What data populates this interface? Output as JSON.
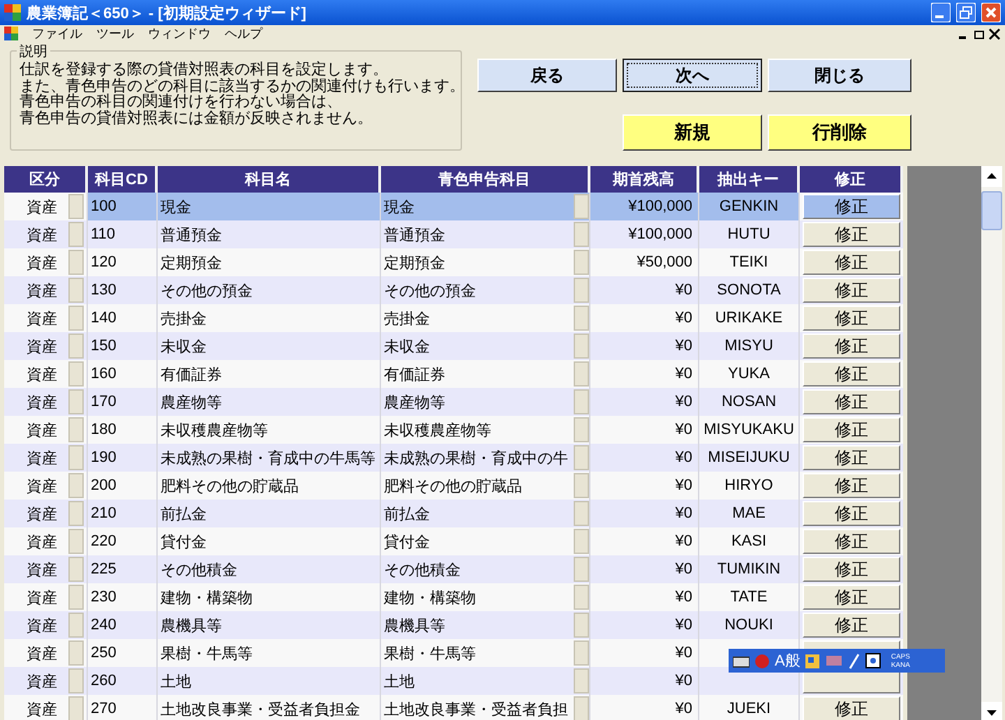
{
  "window": {
    "title": "農業簿記＜650＞ - [初期設定ウィザード]"
  },
  "menu": [
    "ファイル",
    "ツール",
    "ウィンドウ",
    "ヘルプ"
  ],
  "description": {
    "legend": "説明",
    "lines": [
      "仕訳を登録する際の貸借対照表の科目を設定します。",
      "また、青色申告のどの科目に該当するかの関連付けも行います。",
      "青色申告の科目の関連付けを行わない場合は、",
      "青色申告の貸借対照表には金額が反映されません。"
    ]
  },
  "nav_buttons": [
    {
      "label": "戻る",
      "focused": false
    },
    {
      "label": "次へ",
      "focused": true
    },
    {
      "label": "閉じる",
      "focused": false
    }
  ],
  "edit_buttons": [
    "新規",
    "行削除"
  ],
  "table": {
    "columns": [
      "区分",
      "科目CD",
      "科目名",
      "青色申告科目",
      "期首残高",
      "抽出キー",
      "修正"
    ],
    "rows": [
      {
        "category": "資産",
        "code": "100",
        "name": "現金",
        "blue_return_account": "現金",
        "opening_balance": "¥100,000",
        "key": "GENKIN",
        "action": "修正",
        "selected": true
      },
      {
        "category": "資産",
        "code": "110",
        "name": "普通預金",
        "blue_return_account": "普通預金",
        "opening_balance": "¥100,000",
        "key": "HUTU",
        "action": "修正",
        "selected": false
      },
      {
        "category": "資産",
        "code": "120",
        "name": "定期預金",
        "blue_return_account": "定期預金",
        "opening_balance": "¥50,000",
        "key": "TEIKI",
        "action": "修正",
        "selected": false
      },
      {
        "category": "資産",
        "code": "130",
        "name": "その他の預金",
        "blue_return_account": "その他の預金",
        "opening_balance": "¥0",
        "key": "SONOTA",
        "action": "修正",
        "selected": false
      },
      {
        "category": "資産",
        "code": "140",
        "name": "売掛金",
        "blue_return_account": "売掛金",
        "opening_balance": "¥0",
        "key": "URIKAKE",
        "action": "修正",
        "selected": false
      },
      {
        "category": "資産",
        "code": "150",
        "name": "未収金",
        "blue_return_account": "未収金",
        "opening_balance": "¥0",
        "key": "MISYU",
        "action": "修正",
        "selected": false
      },
      {
        "category": "資産",
        "code": "160",
        "name": "有価証券",
        "blue_return_account": "有価証券",
        "opening_balance": "¥0",
        "key": "YUKA",
        "action": "修正",
        "selected": false
      },
      {
        "category": "資産",
        "code": "170",
        "name": "農産物等",
        "blue_return_account": "農産物等",
        "opening_balance": "¥0",
        "key": "NOSAN",
        "action": "修正",
        "selected": false
      },
      {
        "category": "資産",
        "code": "180",
        "name": "未収穫農産物等",
        "blue_return_account": "未収穫農産物等",
        "opening_balance": "¥0",
        "key": "MISYUKAKU",
        "action": "修正",
        "selected": false
      },
      {
        "category": "資産",
        "code": "190",
        "name": "未成熟の果樹・育成中の牛馬等",
        "blue_return_account": "未成熟の果樹・育成中の牛",
        "opening_balance": "¥0",
        "key": "MISEIJUKU",
        "action": "修正",
        "selected": false
      },
      {
        "category": "資産",
        "code": "200",
        "name": "肥料その他の貯蔵品",
        "blue_return_account": "肥料その他の貯蔵品",
        "opening_balance": "¥0",
        "key": "HIRYO",
        "action": "修正",
        "selected": false
      },
      {
        "category": "資産",
        "code": "210",
        "name": "前払金",
        "blue_return_account": "前払金",
        "opening_balance": "¥0",
        "key": "MAE",
        "action": "修正",
        "selected": false
      },
      {
        "category": "資産",
        "code": "220",
        "name": "貸付金",
        "blue_return_account": "貸付金",
        "opening_balance": "¥0",
        "key": "KASI",
        "action": "修正",
        "selected": false
      },
      {
        "category": "資産",
        "code": "225",
        "name": "その他積金",
        "blue_return_account": "その他積金",
        "opening_balance": "¥0",
        "key": "TUMIKIN",
        "action": "修正",
        "selected": false
      },
      {
        "category": "資産",
        "code": "230",
        "name": "建物・構築物",
        "blue_return_account": "建物・構築物",
        "opening_balance": "¥0",
        "key": "TATE",
        "action": "修正",
        "selected": false
      },
      {
        "category": "資産",
        "code": "240",
        "name": "農機具等",
        "blue_return_account": "農機具等",
        "opening_balance": "¥0",
        "key": "NOUKI",
        "action": "修正",
        "selected": false
      },
      {
        "category": "資産",
        "code": "250",
        "name": "果樹・牛馬等",
        "blue_return_account": "果樹・牛馬等",
        "opening_balance": "¥0",
        "selected": false
      },
      {
        "category": "資産",
        "code": "260",
        "name": "土地",
        "blue_return_account": "土地",
        "opening_balance": "¥0",
        "selected": false
      },
      {
        "category": "資産",
        "code": "270",
        "name": "土地改良事業・受益者負担金",
        "blue_return_account": "土地改良事業・受益者負担",
        "opening_balance": "¥0",
        "key": "JUEKI",
        "action": "修正",
        "selected": false
      }
    ]
  },
  "ime_toolbar": {
    "mode": "A般",
    "caps": "CAPS",
    "kana": "KANA"
  }
}
